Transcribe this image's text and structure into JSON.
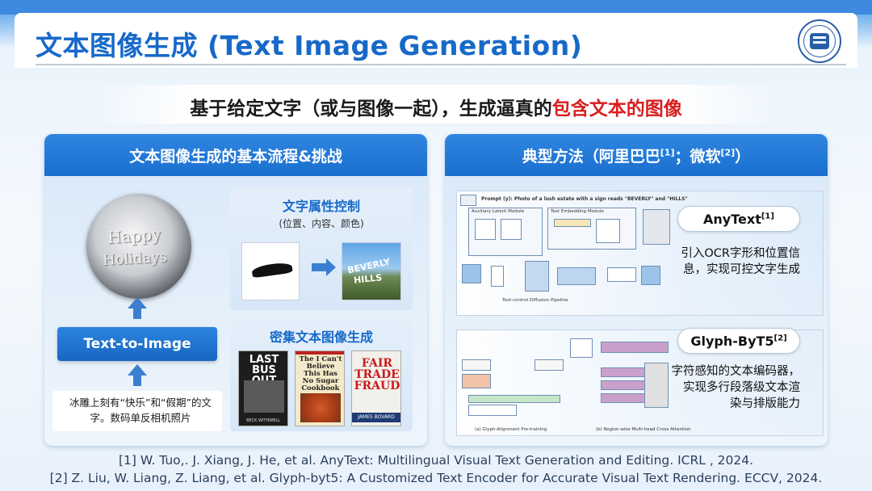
{
  "slide": {
    "title": "文本图像生成 (Text Image Generation)",
    "subtitle_main": "基于给定文字（或与图像一起），生成逼真的",
    "subtitle_highlight": "包含文本的图像"
  },
  "left_panel": {
    "title": "文本图像生成的基本流程&挑战",
    "image_text_line1": "Happy",
    "image_text_line2": "Holidays",
    "button_label": "Text-to-Image",
    "prompt": "冰雕上刻有“快乐”和“假期”的文字。数码单反相机照片",
    "card1": {
      "title": "文字属性控制",
      "subtitle": "(位置、内容、颜色)",
      "hills_line1": "BEVERLY",
      "hills_line2": "HILLS"
    },
    "card2": {
      "title": "密集文本图像生成",
      "book1_title": "LAST BUS OUT",
      "book1_author": "BECK WITHWELL",
      "book2_title": "The I Can't Believe This Has No Sugar Cookbook",
      "book3_title": "FAIR TRADE FRAUD",
      "book3_author": "JAMES BOVARD"
    }
  },
  "right_panel": {
    "title": "典型方法（阿里巴巴",
    "ref1": "[1]",
    "separator": "；微软",
    "ref2": "[2]",
    "close": "）",
    "method1": {
      "name": "AnyText",
      "ref": "[1]",
      "desc_line1": "引入OCR字形和位置信",
      "desc_line2": "息，实现可控文字生成",
      "diagram_prompt": "Prompt (y): Photo of a lush estate with a sign reads \"BEVERLY\" and \"HILLS\"",
      "diagram_module1": "Auxiliary Latent Module",
      "diagram_module2": "Text Embedding Module",
      "diagram_caption": "Text-control Diffusion Pipeline"
    },
    "method2": {
      "name": "Glyph-ByT5",
      "ref": "[2]",
      "desc_line1": "字符感知的文本编码器，",
      "desc_line2": "实现多行段落级文本渲",
      "desc_line3": "染与排版能力",
      "diagram_caption1": "(a) Glyph-Alignment Pre-training",
      "diagram_caption2": "(b) Region-wise Multi-head Cross Attention"
    }
  },
  "references": [
    "[1] W. Tuo,. J. Xiang, J. He, et al. AnyText: Multilingual Visual Text Generation and Editing. ICRL , 2024.",
    "[2] Z. Liu, W. Liang, Z. Liang, et al. Glyph-byt5: A Customized Text Encoder for Accurate Visual Text Rendering. ECCV, 2024."
  ],
  "colors": {
    "title_blue": "#1769c9",
    "highlight_red": "#d81e1e",
    "panel_header": "#1a6fcf"
  }
}
